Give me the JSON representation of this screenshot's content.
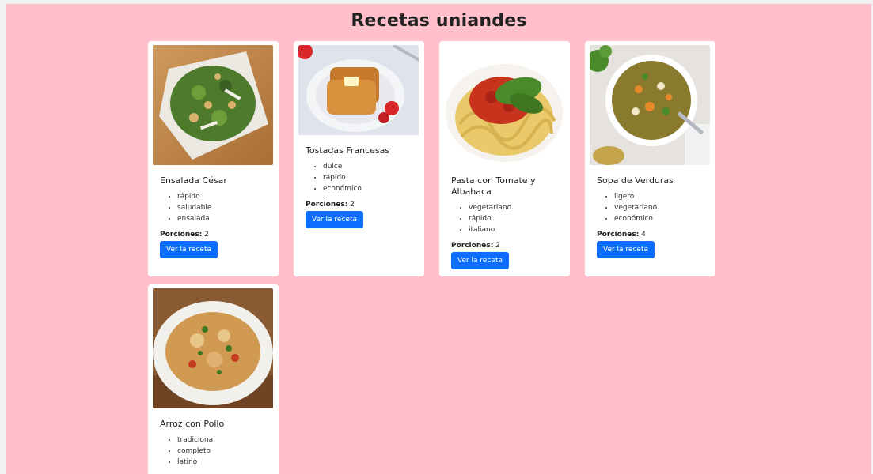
{
  "header": {
    "title": "Recetas uniandes"
  },
  "labels": {
    "portions": "Porciones:",
    "button": "Ver la receta"
  },
  "recipes": [
    {
      "name": "Ensalada César",
      "tags": [
        "rápido",
        "saludable",
        "ensalada"
      ],
      "portions": "2"
    },
    {
      "name": "Tostadas Francesas",
      "tags": [
        "dulce",
        "rápido",
        "económico"
      ],
      "portions": "2"
    },
    {
      "name": "Pasta con Tomate y Albahaca",
      "tags": [
        "vegetariano",
        "rápido",
        "italiano"
      ],
      "portions": "2"
    },
    {
      "name": "Sopa de Verduras",
      "tags": [
        "ligero",
        "vegetariano",
        "económico"
      ],
      "portions": "4"
    },
    {
      "name": "Arroz con Pollo",
      "tags": [
        "tradicional",
        "completo",
        "latino"
      ],
      "portions": ""
    }
  ],
  "colors": {
    "background": "#ffc0cb",
    "button": "#0d6efd",
    "card": "#ffffff"
  }
}
